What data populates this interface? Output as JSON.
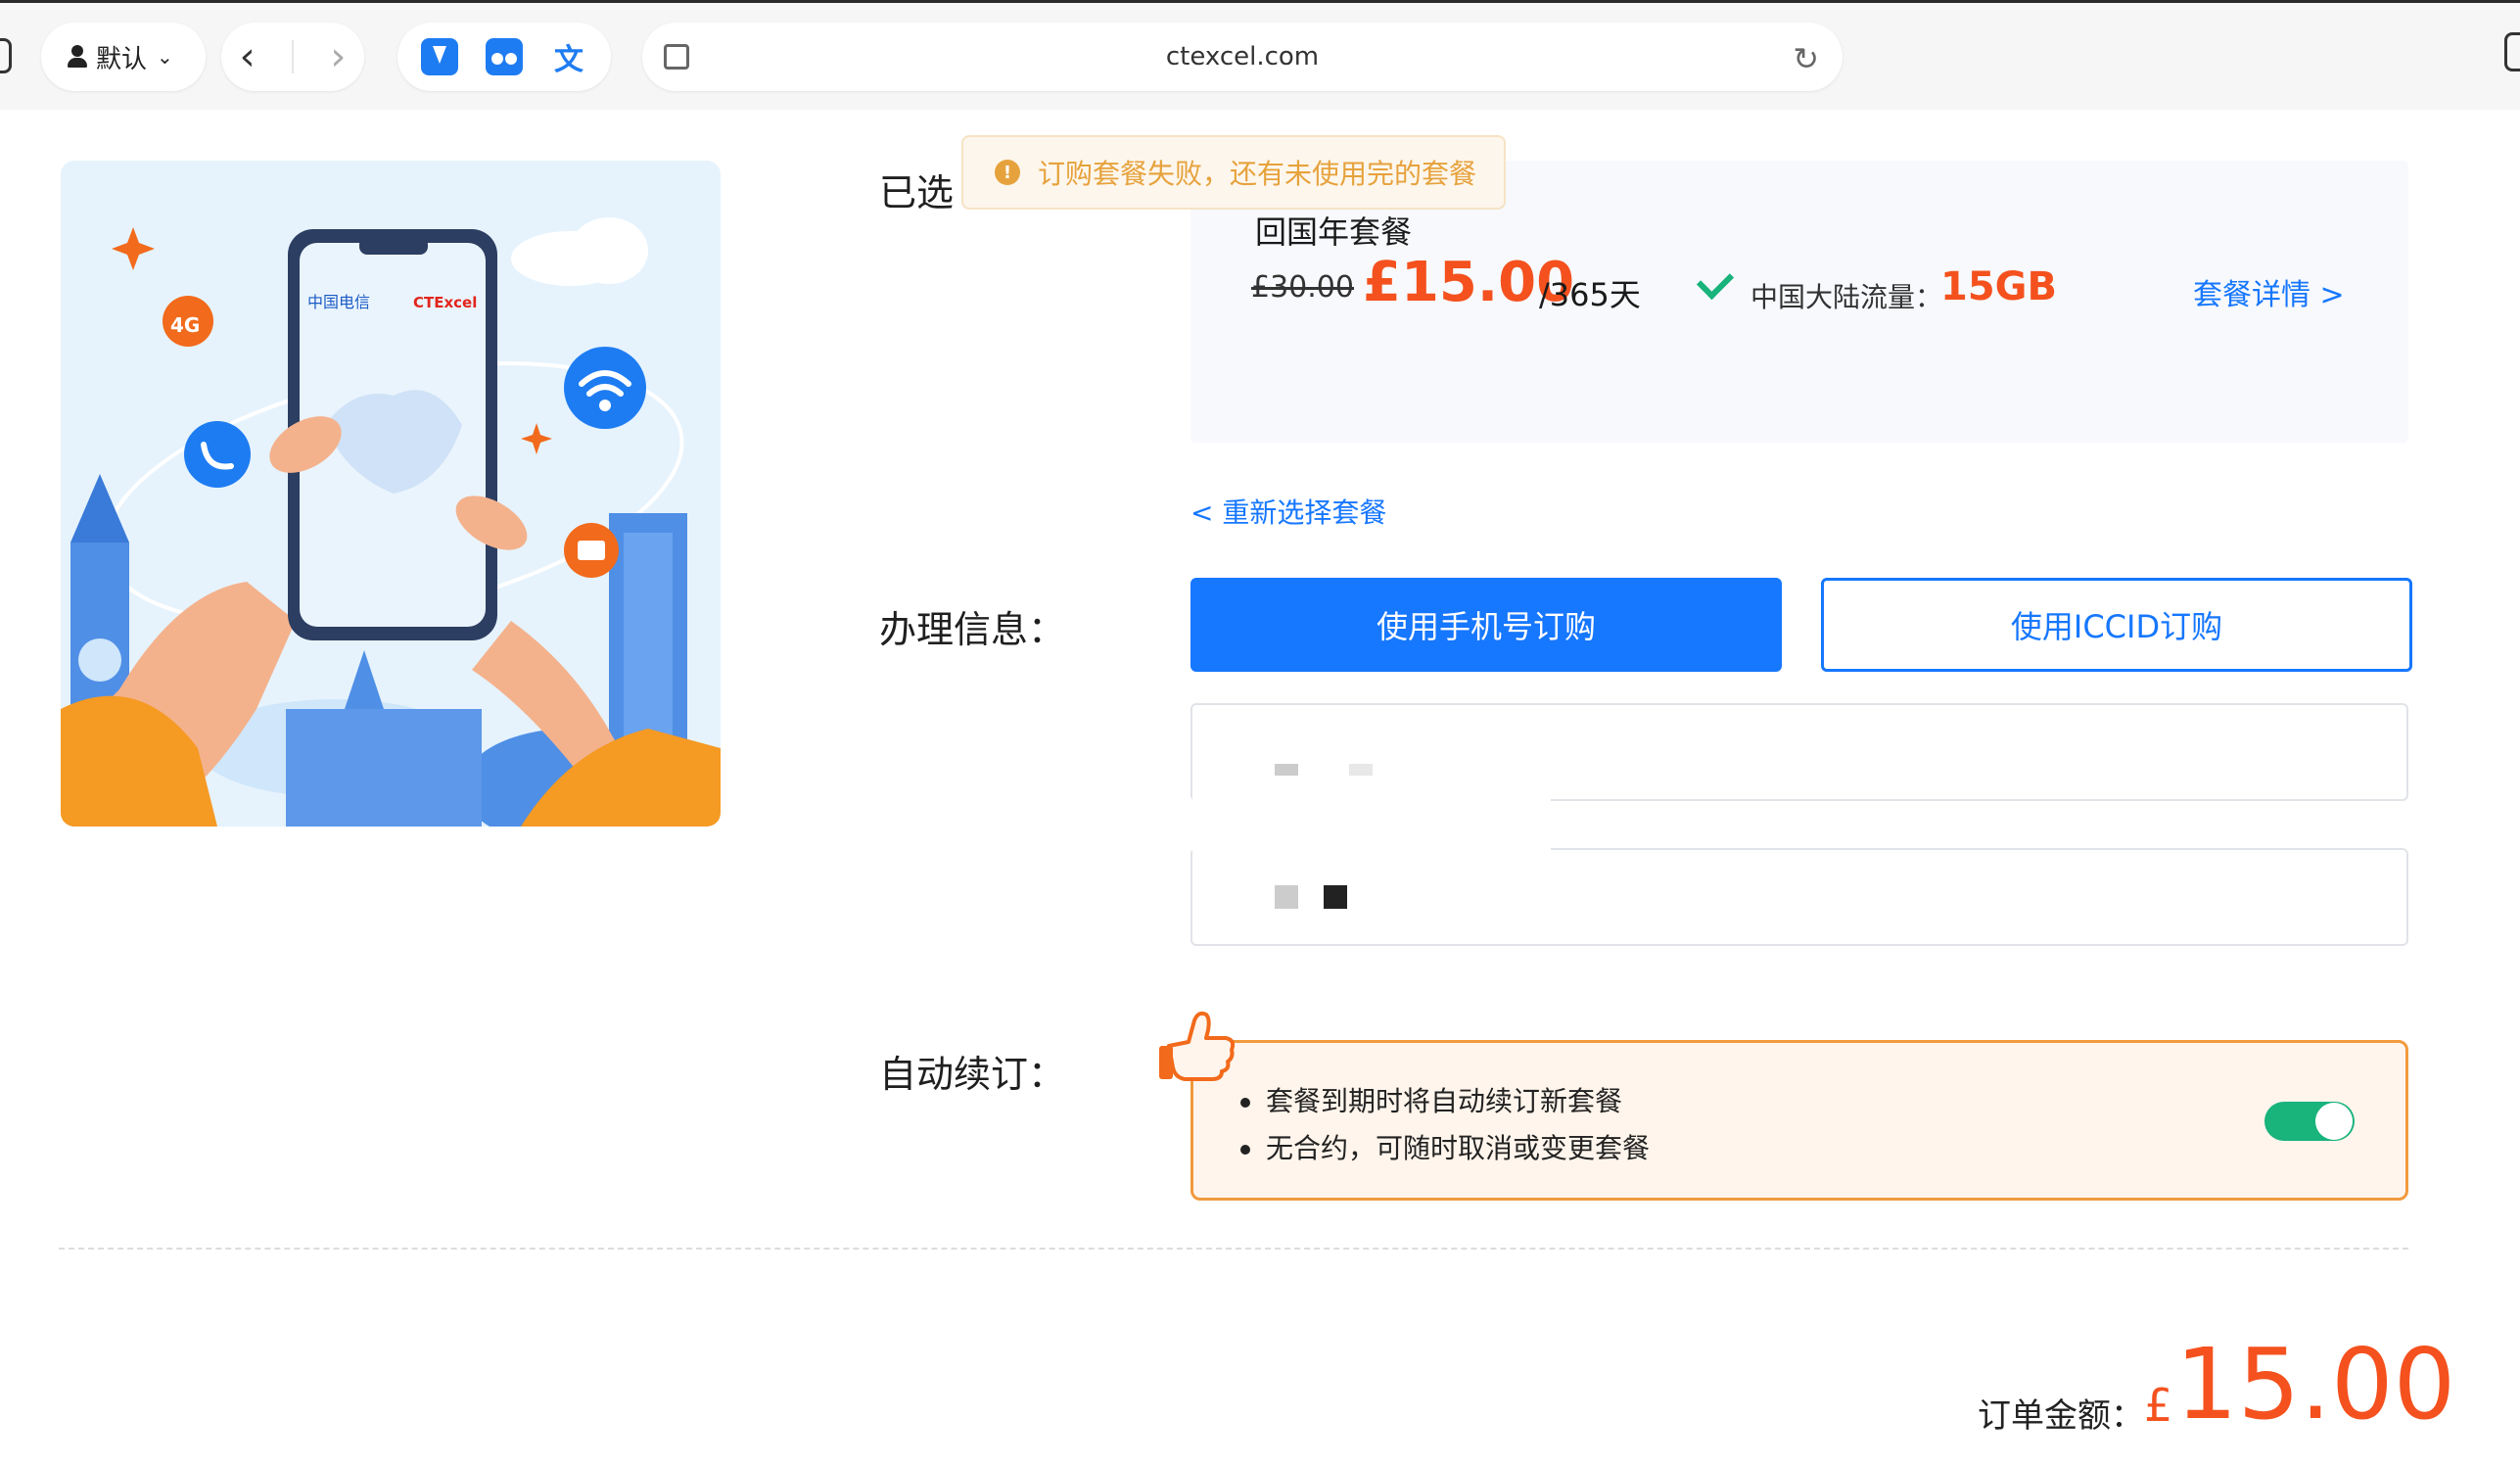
{
  "browser": {
    "profile_label": "默认",
    "url": "ctexcel.com"
  },
  "illustration": {
    "badge_4g": "4G",
    "brand_left": "中国电信",
    "brand_right": "CTExcel"
  },
  "toast": {
    "message": "订购套餐失败，还有未使用完的套餐"
  },
  "selected": {
    "label": "已选",
    "package_name": "回国年套餐",
    "original_price": "£30.00",
    "price": "£15.00",
    "period": "/365天",
    "flow_label": "中国大陆流量：",
    "flow_value": "15GB",
    "detail_link": "套餐详情 >"
  },
  "reselect_link": "< 重新选择套餐",
  "handling": {
    "label": "办理信息：",
    "btn_phone": "使用手机号订购",
    "btn_iccid": "使用ICCID订购"
  },
  "auto_renew": {
    "label": "自动续订：",
    "items": [
      "套餐到期时将自动续订新套餐",
      "无合约，可随时取消或变更套餐"
    ],
    "enabled": true
  },
  "order": {
    "total_label": "订单金额：",
    "currency": "£",
    "total": "15.00"
  },
  "colors": {
    "primary": "#1677ff",
    "price": "#f4511e",
    "toggle_on": "#19b37c",
    "warning": "#e6a23c"
  }
}
